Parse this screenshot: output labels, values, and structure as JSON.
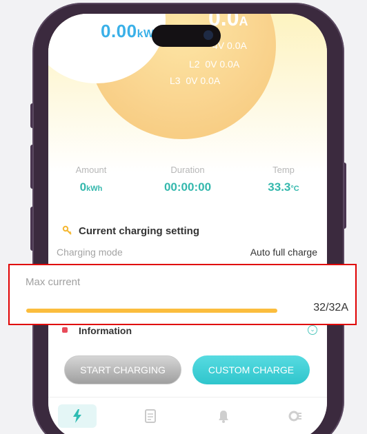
{
  "gauge": {
    "power_value": "0.00",
    "power_unit": "kW",
    "current_partial": "0.0",
    "current_unit": "A",
    "phases": [
      {
        "label": "",
        "voltage": "4V",
        "current": "0.0A"
      },
      {
        "label": "L2",
        "voltage": "0V",
        "current": "0.0A"
      },
      {
        "label": "L3",
        "voltage": "0V",
        "current": "0.0A"
      }
    ]
  },
  "stats": [
    {
      "label": "Amount",
      "value": "0",
      "unit": "kWh"
    },
    {
      "label": "Duration",
      "value": "00:00:00",
      "unit": ""
    },
    {
      "label": "Temp",
      "value": "33.3",
      "unit": "°C"
    }
  ],
  "settings": {
    "title": "Current charging setting",
    "mode_label": "Charging mode",
    "mode_value": "Auto full charge"
  },
  "max_current": {
    "label": "Max current",
    "value": 32,
    "max": 32,
    "display": "32/32A",
    "fill_fraction": 1.0
  },
  "information": {
    "title": "Information"
  },
  "buttons": {
    "start": "START CHARGING",
    "custom": "CUSTOM CHARGE"
  },
  "tabs": [
    {
      "icon": "lightning-icon",
      "active": true
    },
    {
      "icon": "document-icon",
      "active": false
    },
    {
      "icon": "bell-icon",
      "active": false
    },
    {
      "icon": "settings-icon",
      "active": false
    }
  ],
  "colors": {
    "accent_teal": "#34b8ad",
    "power_blue": "#3ab0e8",
    "slider": "#fbbd3d",
    "highlight": "#e00000"
  }
}
